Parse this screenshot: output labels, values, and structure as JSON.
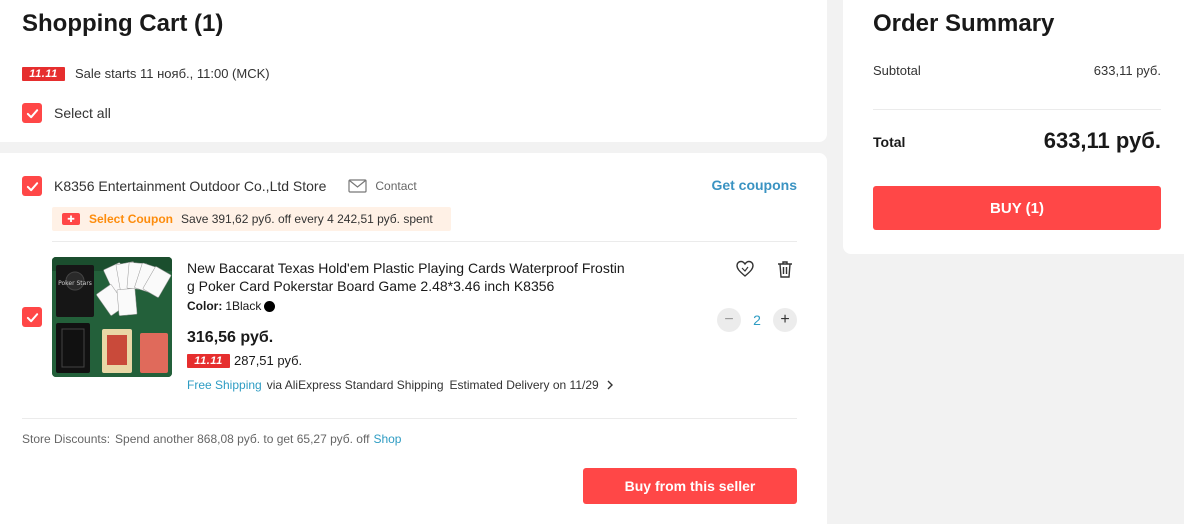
{
  "cart": {
    "title": "Shopping Cart (1)",
    "sale_badge": "11.11",
    "sale_text": "Sale starts 11 нояб., 11:00 (MCK)",
    "select_all": "Select all"
  },
  "store": {
    "name": "K8356 Entertainment Outdoor Co.,Ltd Store",
    "contact": "Contact",
    "get_coupons": "Get coupons",
    "coupon_label": "Select Coupon",
    "coupon_text": "Save 391,62 руб. off every 4 242,51 руб. spent",
    "discount_label": "Store Discounts:",
    "discount_text": "Spend another 868,08 руб. to get 65,27 руб. off",
    "discount_link": "Shop",
    "buy_button": "Buy from this seller"
  },
  "item": {
    "title_line1": "New Baccarat Texas Hold'em Plastic Playing Cards Waterproof Frostin",
    "title_line2": "g Poker Card Pokerstar Board Game 2.48*3.46 inch K8356",
    "color_label": "Color:",
    "color_value": "1Black",
    "price": "316,56 руб.",
    "sale_badge": "11.11",
    "sale_price": "287,51 руб.",
    "shipping_free": "Free Shipping",
    "shipping_via": "via AliExpress Standard Shipping",
    "delivery": "Estimated Delivery on 11/29",
    "quantity": "2",
    "image_text": "Poker Stars"
  },
  "summary": {
    "title": "Order Summary",
    "subtotal_label": "Subtotal",
    "subtotal_value": "633,11 руб.",
    "total_label": "Total",
    "total_value": "633,11 руб.",
    "buy_button": "BUY (1)"
  },
  "colors": {
    "accent": "#ff4747",
    "link": "#2e9cc3",
    "coupon_orange": "#fd8c0c"
  }
}
